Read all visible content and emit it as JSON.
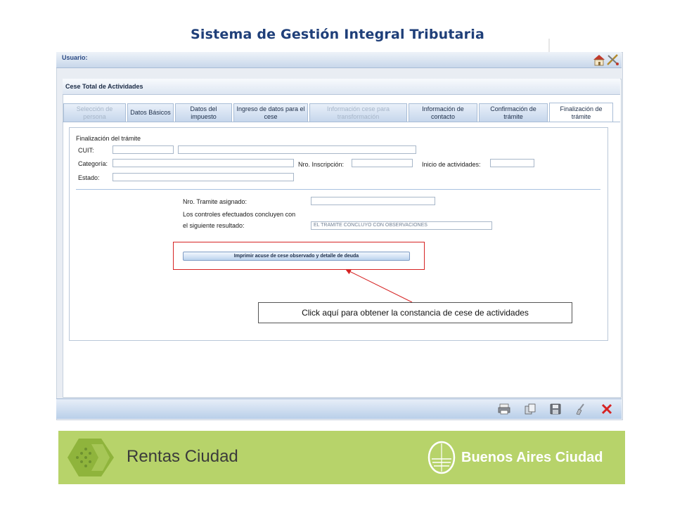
{
  "header": {
    "title": "Sistema de Gestión Integral Tributaria"
  },
  "userbar": {
    "label": "Usuario:",
    "icons": [
      "home-icon",
      "tools-icon"
    ]
  },
  "panel": {
    "title": "Cese Total de Actividades"
  },
  "tabs": [
    {
      "label": "Selección de persona",
      "state": "disabled"
    },
    {
      "label": "Datos Básicos",
      "state": "enabled"
    },
    {
      "label": "Datos del impuesto",
      "state": "enabled"
    },
    {
      "label": "Ingreso de datos para el cese",
      "state": "enabled"
    },
    {
      "label": "Información cese para transformación",
      "state": "disabled"
    },
    {
      "label": "Información de contacto",
      "state": "enabled"
    },
    {
      "label": "Confirmación de trámite",
      "state": "enabled"
    },
    {
      "label": "Finalización de trámite",
      "state": "active"
    }
  ],
  "form": {
    "section_title": "Finalización del trámite",
    "cuit_label": "CUIT:",
    "categoria_label": "Categoría:",
    "nro_inscripcion_label": "Nro. Inscripción:",
    "inicio_actividades_label": "Inicio de actividades:",
    "estado_label": "Estado:",
    "nro_tramite_label": "Nro. Tramite asignado:",
    "controles_line1": "Los controles efectuados concluyen con",
    "controles_line2": "el siguiente resultado:",
    "resultado_value": "EL TRAMITE CONCLUYO CON OBSERVACIONES"
  },
  "actions": {
    "print_label": "Imprimir acuse de cese observado y detalle de deuda"
  },
  "callout": {
    "text": "Click aquí para obtener la constancia de cese de actividades"
  },
  "toolbar": {
    "icons": [
      "printer-icon",
      "copy-icon",
      "save-icon",
      "clear-icon",
      "close-icon"
    ]
  },
  "colors": {
    "title": "#1f3f79",
    "banner": "#b7d36a",
    "callout_border": "#d62323"
  },
  "footer": {
    "left_brand": "Rentas Ciudad",
    "right_brand": "Buenos Aires Ciudad"
  }
}
